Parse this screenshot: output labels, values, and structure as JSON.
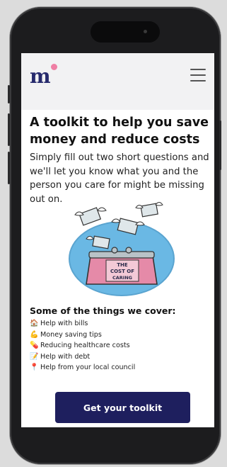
{
  "header": {
    "logo_text": "m",
    "menu_icon": "hamburger-menu-icon"
  },
  "hero": {
    "title": "A toolkit to help you save money and reduce costs",
    "body": "Simply fill out two short questions and we'll let you know what you and the person you care for might be missing out on."
  },
  "illustration": {
    "label_line1": "THE",
    "label_line2": "COST OF",
    "label_line3": "CARING"
  },
  "covers": {
    "heading": "Some of the things we cover:",
    "items": [
      {
        "icon": "house-icon",
        "glyph": "🏠",
        "label": "Help with bills"
      },
      {
        "icon": "flexed-arm-icon",
        "glyph": "💪",
        "label": "Money saving tips"
      },
      {
        "icon": "pill-icon",
        "glyph": "💊",
        "label": "Reducing healthcare costs"
      },
      {
        "icon": "memo-icon",
        "glyph": "📝",
        "label": "Help with debt"
      },
      {
        "icon": "pin-icon",
        "glyph": "📍",
        "label": "Help from your local council"
      }
    ]
  },
  "cta": {
    "label": "Get your toolkit"
  },
  "colors": {
    "brand_navy": "#1e1f5e",
    "logo_dot_pink": "#ef7fa4",
    "illustration_blue": "#6ab8e4"
  }
}
